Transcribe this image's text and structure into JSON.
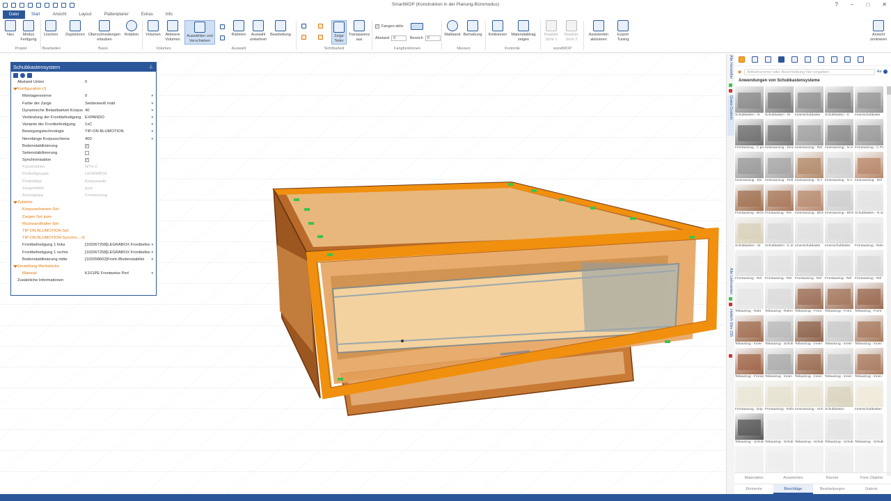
{
  "title": "SmartWOP (Konstruktion in der Planung-Büromodus)",
  "file_tab": "Datei",
  "tabs": [
    "Start",
    "Ansicht",
    "Layout",
    "Plattenplaner",
    "Extras",
    "Info"
  ],
  "ribbon": {
    "buttons": {
      "neu": "Neu",
      "modus_fertigung": "Modus\nFertigung",
      "loeschen": "Löschen",
      "duplizieren": "Duplizieren",
      "ueberschneidungen": "Überschneidungen\nerlauben",
      "rotation": "Rotation",
      "volumen": "Volumen",
      "aktiviere_volumen": "Aktiviere\nVolumen",
      "auswaehlen": "Auswählen und\nVerschieben",
      "rahmen": "Rahmen",
      "auswahl_umkehren": "Auswahl\numkehren",
      "bearbeitung": "Bearbeitung",
      "zeige_teiler": "Zeige\nTeiler",
      "transparenz": "Transparenz\naus",
      "massband": "Maßband",
      "bemassung": "Bemaßung",
      "kollisionen": "Kollisionen",
      "materialabtrag": "Materialabtrag\nzeigen",
      "realistic1": "Realistic\nSicht 1",
      "realistic2": "Realistic\nSicht 2",
      "assistenten": "Assistenten\naktivieren",
      "export": "Export\nTuning",
      "ansicht_zentrieren": "Ansicht\nzentrieren"
    },
    "fangen_aktiv": "Fangen aktiv",
    "abstand_label": "Abstand",
    "abstand_value": "0",
    "bereich_label": "Bereich",
    "bereich_value": "0",
    "groups": {
      "projekt": "Projekt",
      "bearbeiten": "Bearbeiten",
      "basis": "Basis",
      "volumen": "Volumen",
      "auswahl": "Auswahl",
      "sichtbarkeit": "Sichtbarkeit",
      "fangfunktionen": "Fangfunktionen",
      "messen": "Messen",
      "kontrolle": "Kontrolle",
      "woodwop": "woodWOP"
    }
  },
  "props": {
    "title": "Schubkastensystem",
    "rows": [
      {
        "label": "Abstand Unten",
        "value": "0",
        "kind": "lvl0"
      },
      {
        "label": "Konfiguration (/)",
        "value": "",
        "kind": "sec"
      },
      {
        "label": "Montagereserve",
        "value": "0",
        "kind": "row",
        "dd": "▾"
      },
      {
        "label": "Farbe der Zarge",
        "value": "Seidenweiß matt",
        "kind": "row",
        "dd": "▾"
      },
      {
        "label": "Dynamische Belastbarkeit Korpus",
        "value": "40",
        "kind": "row",
        "dd": "▾"
      },
      {
        "label": "Verbindung der Frontbefestigung",
        "value": "EXPANDO",
        "kind": "row",
        "dd": "▾"
      },
      {
        "label": "Variante der Frontbefestigung",
        "value": "1xC",
        "kind": "row",
        "dd": "▾"
      },
      {
        "label": "Bewegungstechnologie",
        "value": "TIP-ON BLUMOTION",
        "kind": "row",
        "dd": "▾"
      },
      {
        "label": "Nennlänge Korpusschiene",
        "value": "400",
        "kind": "row",
        "dd": "▾"
      },
      {
        "label": "Bodenstabilisierung",
        "value": "",
        "kind": "check",
        "checked": "✓"
      },
      {
        "label": "Seitenstabilisierung",
        "value": "",
        "kind": "check",
        "checked": ""
      },
      {
        "label": "Synchronisation",
        "value": "",
        "kind": "check",
        "checked": "✓"
      },
      {
        "label": "Konstruktion",
        "value": "N/Tn C",
        "kind": "dim"
      },
      {
        "label": "Produktgruppe",
        "value": "LEGRABOX",
        "kind": "dim"
      },
      {
        "label": "Produkttyp",
        "value": "Korpusseite",
        "kind": "dim"
      },
      {
        "label": "Zargenhöhe",
        "value": "pure",
        "kind": "dim"
      },
      {
        "label": "Auszugstyp",
        "value": "Frontauszug",
        "kind": "dim"
      },
      {
        "label": "Zubehör",
        "value": "",
        "kind": "sec"
      },
      {
        "label": "Korpusschienen-Set",
        "value": "",
        "kind": "link"
      },
      {
        "label": "Zargen-Set pure",
        "value": "",
        "kind": "link"
      },
      {
        "label": "Rückwandhalter-Set",
        "value": "",
        "kind": "link"
      },
      {
        "label": "TIP-ON BLUMOTION-Set",
        "value": "",
        "kind": "link"
      },
      {
        "label": "TIP-ON BLUMOTION-Synchro...-Se",
        "value": "",
        "kind": "link"
      },
      {
        "label": "Frontbefestigung 1 links",
        "value": "[103367258]LEGRABOX Frontbefes",
        "kind": "row",
        "dd": "▾"
      },
      {
        "label": "Frontbefestigung 1 rechts",
        "value": "[103367258]LEGRABOX Frontbefes",
        "kind": "row",
        "dd": "▾"
      },
      {
        "label": "Bodenstabilisierung mitte",
        "value": "[103358602]Front-/Bodenstabilisi",
        "kind": "row",
        "dd": "▾"
      },
      {
        "label": "Einstellung Werkstücke",
        "value": "",
        "kind": "sec"
      },
      {
        "label": "Material",
        "value": "K101PE Frontweiss Perl",
        "kind": "linkval",
        "dd": "▾"
      },
      {
        "label": "Zusätzliche Informationen",
        "value": "",
        "kind": "lvl0"
      }
    ]
  },
  "right_vtabs": [
    "Alle Hersteller",
    "Grass Custom",
    "Alle Lieferanten",
    "Hettich Slim 235"
  ],
  "right_panel": {
    "search_placeholder": "Artikelnummer oder Beschreibung hier eingeben",
    "aa": "Aa",
    "heading": "Anwendungen von Schubkastensysteme",
    "items": [
      {
        "caption": "Schubkasten - N",
        "color": "#8a8a8a"
      },
      {
        "caption": "Schubkasten - M",
        "color": "#7d7d7d"
      },
      {
        "caption": "Innenschubkaste",
        "color": "#909090"
      },
      {
        "caption": "Schubkasten - K",
        "color": "#858585"
      },
      {
        "caption": "Innenschubkaste",
        "color": "#959595"
      },
      {
        "caption": "Frontauszug - C pu",
        "color": "#6f6f6f"
      },
      {
        "caption": "Innenauszug - Einz",
        "color": "#7a7a7a"
      },
      {
        "caption": "Innenauszug - Rel",
        "color": "#a0a0a0"
      },
      {
        "caption": "Innenauszug - N m",
        "color": "#8c8c8c"
      },
      {
        "caption": "Frontauszug - C Fre",
        "color": "#9a9a9a"
      },
      {
        "caption": "Innenauszug - Ein",
        "color": "#999999"
      },
      {
        "caption": "Innenauszug - Relt",
        "color": "#a5a5a5"
      },
      {
        "caption": "Innenauszug - N n",
        "color": "#b28a6a"
      },
      {
        "caption": "Innenauszug - N n",
        "color": "#d0d0d0"
      },
      {
        "caption": "Innenauszug - Rel",
        "color": "#b8876a"
      },
      {
        "caption": "Frontauszug - BOX",
        "color": "#a0704f"
      },
      {
        "caption": "Frontauszug - Rei",
        "color": "#a8775a"
      },
      {
        "caption": "Innenauszug - BOX",
        "color": "#b88a6f"
      },
      {
        "caption": "Innenauszug - BOX",
        "color": "#cfcfcf"
      },
      {
        "caption": "Schubkasten - N ar",
        "color": "#e3e3e3"
      },
      {
        "caption": "Schubkasten - W",
        "color": "#d8d0b8"
      },
      {
        "caption": "Schubkasten - K ar",
        "color": "#d9d9d9"
      },
      {
        "caption": "Innenschubkaste",
        "color": "#e0e0e0"
      },
      {
        "caption": "Innenschubkaste",
        "color": "#dcdcdc"
      },
      {
        "caption": "Frontauszug - Rele",
        "color": "#e4e4e4"
      },
      {
        "caption": "Frontauszug - Rel",
        "color": "#dedede"
      },
      {
        "caption": "Frontauszug - Rel",
        "color": "#e2e2e2"
      },
      {
        "caption": "Frontauszug - Rel",
        "color": "#d6d6d6"
      },
      {
        "caption": "Frontauszug - Rel",
        "color": "#e0e0e0"
      },
      {
        "caption": "Frontauszug - Rel",
        "color": "#d9d9d9"
      },
      {
        "caption": "Teilauszug - Rahr",
        "color": "#e6e6e6"
      },
      {
        "caption": "Teilauszug - Rahm",
        "color": "#dbdbdb"
      },
      {
        "caption": "Teilauszug - Front",
        "color": "#9c6e55"
      },
      {
        "caption": "Teilauszug - Front",
        "color": "#a3765c"
      },
      {
        "caption": "Teilauszug - Front",
        "color": "#9a6a50"
      },
      {
        "caption": "Teilauszug - Innen",
        "color": "#a06e52"
      },
      {
        "caption": "Teilauszug - Schub",
        "color": "#b9b9b9"
      },
      {
        "caption": "Teilauszug - Innen",
        "color": "#8e6249"
      },
      {
        "caption": "Teilauszug - Innen",
        "color": "#c9c9c9"
      },
      {
        "caption": "Teilauszug - Innen",
        "color": "#a87a5e"
      },
      {
        "caption": "Teilauszug - Fronta",
        "color": "#a0664a"
      },
      {
        "caption": "Teilauszug - Innen",
        "color": "#ababab"
      },
      {
        "caption": "Teilauszug - Innen",
        "color": "#9a6c51"
      },
      {
        "caption": "Teilauszug - Innen",
        "color": "#c5c5c5"
      },
      {
        "caption": "Teilauszug - Innen",
        "color": "#a97b60"
      },
      {
        "caption": "Frontauszug - Dop",
        "color": "#eae5d6"
      },
      {
        "caption": "Frontauszug - Rahe",
        "color": "#e6e1cf"
      },
      {
        "caption": "Innenauszug - Hori",
        "color": "#e8e3d2"
      },
      {
        "caption": "Schubkasten",
        "color": "#d9d3bd"
      },
      {
        "caption": "Innenschubkasten",
        "color": "#efe9d8"
      },
      {
        "caption": "Teilauszug - Schubk",
        "color": "#555555"
      },
      {
        "caption": "Teilauszug - Schub",
        "color": "#e9e9e9"
      },
      {
        "caption": "Teilauszug - Schub",
        "color": "#ececec"
      },
      {
        "caption": "Teilauszug - Schub",
        "color": "#e3e3e3"
      },
      {
        "caption": "Teilauszug - Schubk",
        "color": "#eeeeee"
      },
      {
        "caption": "",
        "color": "#f0f0f0"
      },
      {
        "caption": "",
        "color": "#eeeeee"
      },
      {
        "caption": "",
        "color": "#f1f1f1"
      },
      {
        "caption": "",
        "color": "#ededed"
      },
      {
        "caption": "",
        "color": "#f0f0f0"
      }
    ],
    "bottom_tabs_1": [
      "Materialien",
      "Assistenten",
      "Räume",
      "Freie Objekte"
    ],
    "bottom_tabs_2": [
      "Elemente",
      "Beschläge",
      "Bearbeitungen",
      "Galerie"
    ]
  },
  "colors": {
    "accent": "#2b579a",
    "frame_orange": "#f0900e",
    "panel_brown": "#8a4a18",
    "glass": "#f5cf8a",
    "green_marker": "#3fc24a",
    "link_orange": "#e07a10"
  }
}
